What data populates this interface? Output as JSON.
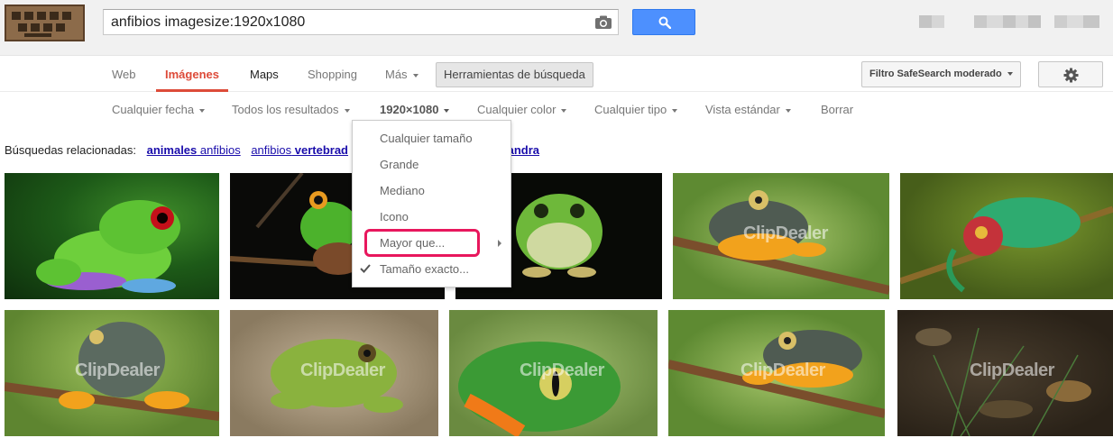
{
  "search": {
    "query": "anfibios imagesize:1920x1080"
  },
  "nav": {
    "web": "Web",
    "images": "Imágenes",
    "maps": "Maps",
    "shopping": "Shopping",
    "more": "Más",
    "tools": "Herramientas de búsqueda",
    "safesearch": "Filtro SafeSearch moderado"
  },
  "filters": {
    "date": "Cualquier fecha",
    "results": "Todos los resultados",
    "size": "1920×1080",
    "color": "Cualquier color",
    "type": "Cualquier tipo",
    "view": "Vista estándar",
    "clear": "Borrar"
  },
  "related": {
    "label": "Búsquedas relacionadas:",
    "links": [
      {
        "pre": "animales",
        "rest": " anfibios"
      },
      {
        "pre": "anfibios",
        "rest": " vertebrad"
      },
      {
        "pre": "",
        "rest": "es"
      },
      {
        "pre": "salamandra",
        "rest": ""
      }
    ]
  },
  "size_menu": {
    "items": [
      "Cualquier tamaño",
      "Grande",
      "Mediano",
      "Icono",
      "Mayor que...",
      "Tamaño exacto..."
    ],
    "checked": "Tamaño exacto...",
    "highlighted": "Mayor que..."
  },
  "watermark": "ClipDealer",
  "colors": {
    "accent_red": "#dd4b39",
    "search_blue": "#4d90fe",
    "link": "#1a0dab",
    "highlight_pink": "#e8175d"
  },
  "icons": [
    "camera-icon",
    "search-icon",
    "gear-icon",
    "checkmark-icon"
  ]
}
